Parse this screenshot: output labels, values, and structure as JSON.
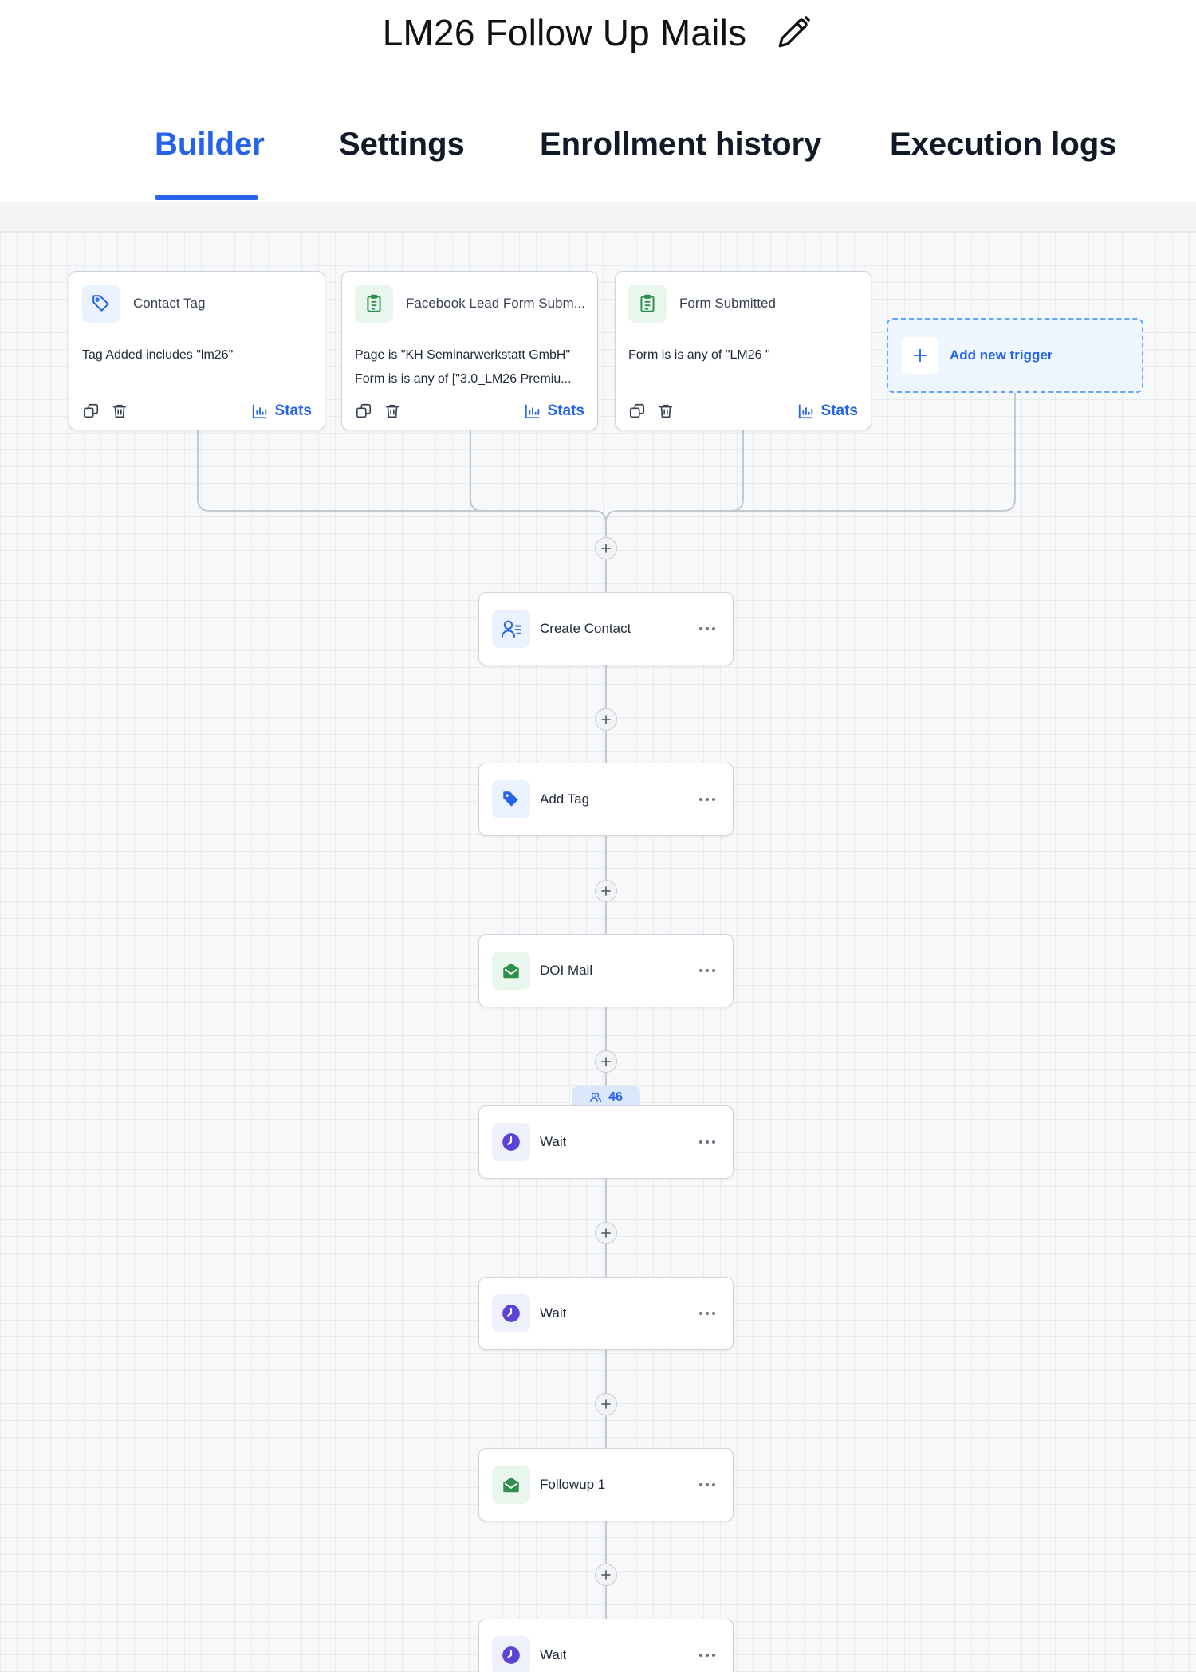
{
  "header": {
    "title": "LM26 Follow Up Mails"
  },
  "tabs": [
    {
      "label": "Builder",
      "active": true
    },
    {
      "label": "Settings",
      "active": false
    },
    {
      "label": "Enrollment history",
      "active": false
    },
    {
      "label": "Execution logs",
      "active": false
    }
  ],
  "triggers": [
    {
      "title": "Contact Tag",
      "icon": "tag-outline-icon",
      "conditions": [
        "Tag Added includes \"lm26\""
      ],
      "stats_label": "Stats"
    },
    {
      "title": "Facebook Lead Form Subm...",
      "icon": "clipboard-icon",
      "conditions": [
        "Page is \"KH Seminarwerkstatt GmbH\"",
        "Form is is any of [\"3.0_LM26 Premiu..."
      ],
      "stats_label": "Stats"
    },
    {
      "title": "Form Submitted",
      "icon": "clipboard-icon",
      "conditions": [
        "Form is is any of \"LM26 \""
      ],
      "stats_label": "Stats"
    }
  ],
  "add_trigger": {
    "label": "Add new trigger"
  },
  "actions": [
    {
      "label": "Create Contact",
      "icon": "contact-icon"
    },
    {
      "label": "Add Tag",
      "icon": "tag-icon"
    },
    {
      "label": "DOI Mail",
      "icon": "email-icon"
    },
    {
      "label": "Wait",
      "icon": "clock-icon"
    },
    {
      "label": "Wait",
      "icon": "clock-icon"
    },
    {
      "label": "Followup 1",
      "icon": "email-icon"
    },
    {
      "label": "Wait",
      "icon": "clock-icon"
    }
  ],
  "enrollment_badge": {
    "count": "46"
  },
  "colors": {
    "accent": "#2563eb",
    "trigger_blue_bg": "#eaf1ff",
    "trigger_green_bg": "#e8f6ee",
    "email_green": "#2f8f4e",
    "wait_purple": "#5b43d6"
  }
}
